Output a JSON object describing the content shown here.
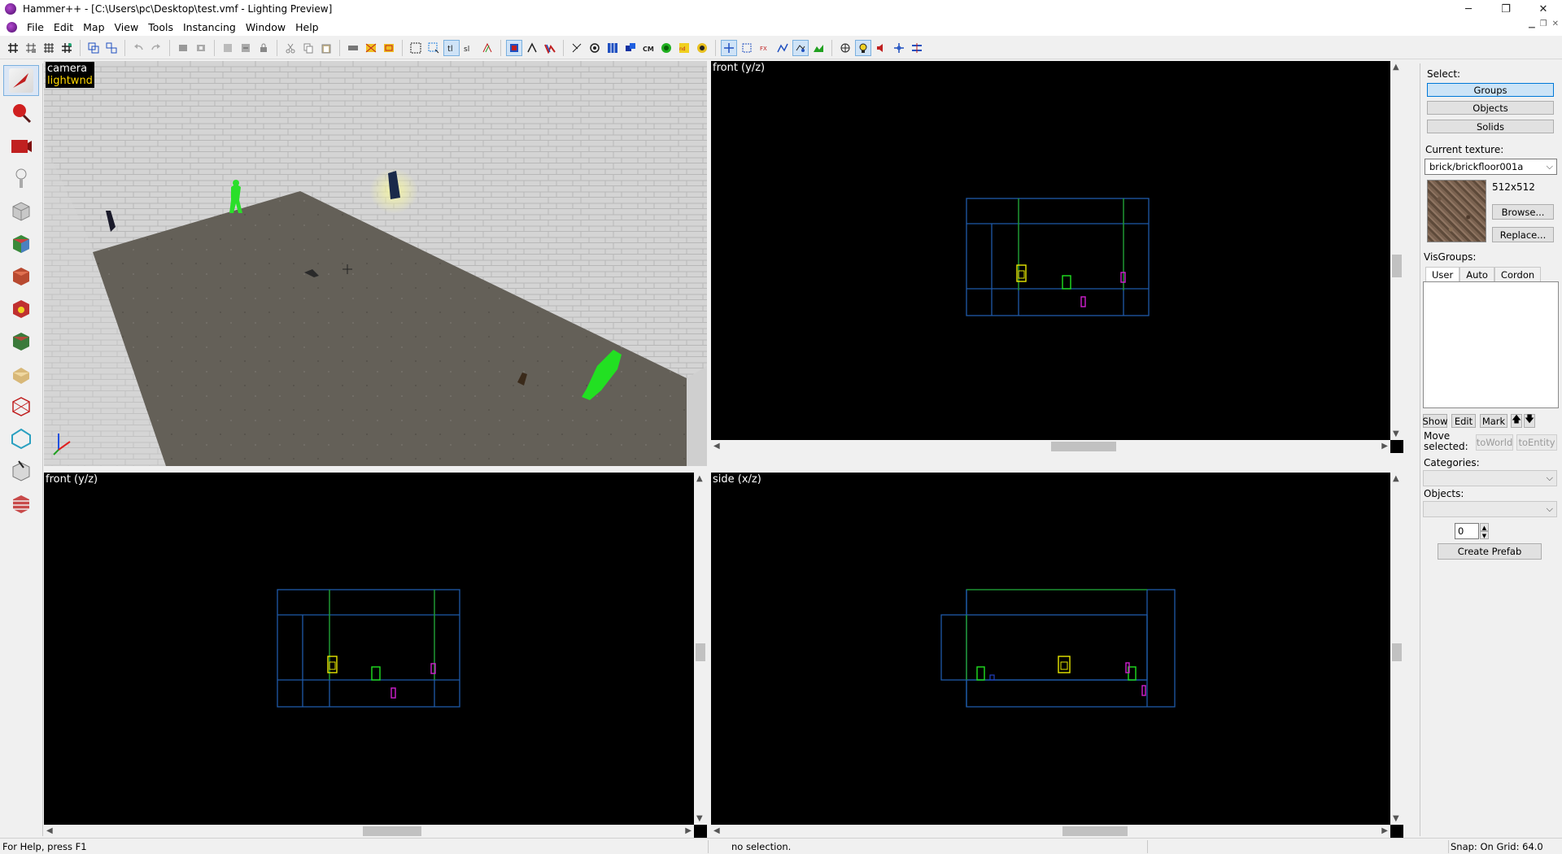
{
  "window": {
    "title": "Hammer++ - [C:\\Users\\pc\\Desktop\\test.vmf - Lighting Preview]",
    "minimize": "─",
    "maximize": "❐",
    "close": "✕"
  },
  "menu": [
    "File",
    "Edit",
    "Map",
    "View",
    "Tools",
    "Instancing",
    "Window",
    "Help"
  ],
  "viewports": {
    "camera": {
      "line1": "camera",
      "line2": "lightwnd"
    },
    "top_right": {
      "label": "front (y/z)"
    },
    "bottom_left": {
      "label": "front (y/z)"
    },
    "bottom_right": {
      "label": "side (x/z)"
    }
  },
  "right_panel": {
    "select_label": "Select:",
    "select_buttons": [
      "Groups",
      "Objects",
      "Solids"
    ],
    "current_texture_label": "Current texture:",
    "texture_name": "brick/brickfloor001a",
    "texture_size": "512x512",
    "browse": "Browse...",
    "replace": "Replace...",
    "visgroups_label": "VisGroups:",
    "tabs": [
      "User",
      "Auto",
      "Cordon"
    ],
    "show": "Show",
    "edit": "Edit",
    "mark": "Mark",
    "up": "🡅",
    "down": "🡇",
    "move_selected": "Move selected:",
    "to_world": "toWorld",
    "to_entity": "toEntity",
    "categories_label": "Categories:",
    "objects_label": "Objects:",
    "objects_count": "0",
    "create_prefab": "Create Prefab"
  },
  "status": {
    "help": "For Help, press F1",
    "selection": "no selection.",
    "snap": "Snap: On Grid: 64.0"
  },
  "colors": {
    "grid_blue": "#1e5aa8",
    "brush_green": "#1fa01f",
    "entity_yellow": "#e8e800",
    "entity_magenta": "#d020d0",
    "entity_green": "#20e020"
  }
}
